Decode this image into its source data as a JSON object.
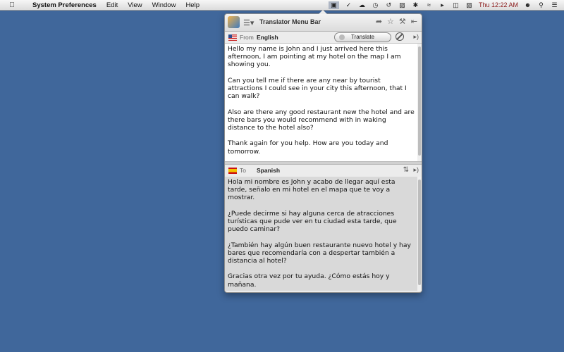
{
  "menubar": {
    "apple_icon": "apple-icon",
    "app_name": "System Preferences",
    "items": [
      "Edit",
      "View",
      "Window",
      "Help"
    ],
    "clock": "Thu 12:22 AM"
  },
  "panel": {
    "title": "Translator Menu Bar",
    "from_label": "From",
    "from_language": "English",
    "translate_button": "Translate",
    "to_label": "To",
    "to_language": "Spanish",
    "source_text": [
      "Hello my name is John and I just arrived here this afternoon, I am pointing at my hotel on the map I am showing you.",
      "Can you tell me if there are any near by tourist attractions I could see in your city this afternoon, that I can walk?",
      "Also are there any good restaurant new the hotel and are there bars you would recommend with in waking distance to the hotel also?",
      "Thank again for you help. How are you today and tomorrow."
    ],
    "translated_text": [
      "Hola mi nombre es John y acabo de llegar aquí esta tarde, señalo en mi hotel en el mapa que te voy a mostrar.",
      "¿Puede decirme si hay alguna cerca de atracciones turísticas que pude ver en tu ciudad esta tarde, que puedo caminar?",
      "¿También hay algún buen restaurante nuevo hotel y hay bares que recomendaría con a despertar también a distancia al hotel?",
      "Gracias otra vez por tu ayuda. ¿Cómo estás hoy y mañana."
    ]
  },
  "colors": {
    "desktop": "#40679b",
    "clock_text": "#8b1a1a"
  }
}
